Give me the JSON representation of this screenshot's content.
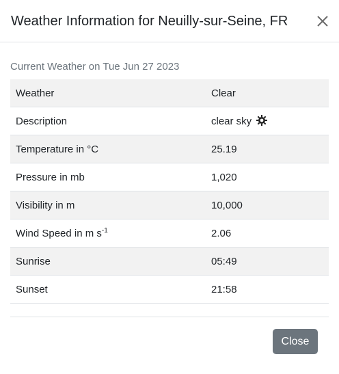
{
  "modal": {
    "title": "Weather Information for Neuilly-sur-Seine, FR",
    "caption": "Current Weather on Tue Jun 27 2023",
    "close_button_label": "Close"
  },
  "rows": [
    {
      "label": "Weather",
      "value": "Clear"
    },
    {
      "label": "Description",
      "value": "clear sky",
      "icon": "sun-icon"
    },
    {
      "label": "Temperature in °C",
      "value": "25.19"
    },
    {
      "label": "Pressure in mb",
      "value": "1,020"
    },
    {
      "label": "Visibility in m",
      "value": "10,000"
    },
    {
      "label": "Wind Speed in m s",
      "label_superscript": "-1",
      "value": "2.06"
    },
    {
      "label": "Sunrise",
      "value": "05:49"
    },
    {
      "label": "Sunset",
      "value": "21:58"
    }
  ],
  "colors": {
    "button": "#6c757d",
    "stripe": "#f2f2f2",
    "border": "#dee2e6"
  }
}
